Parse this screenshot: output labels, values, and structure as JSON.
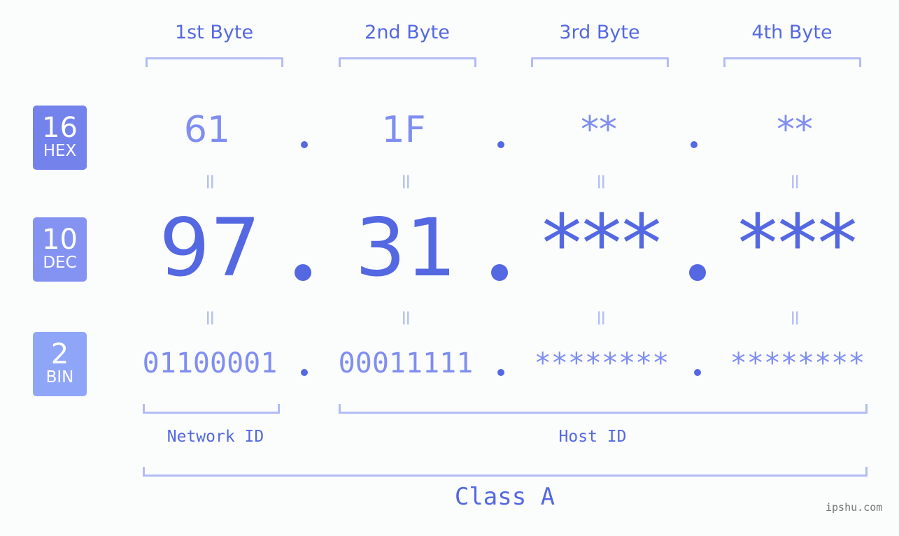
{
  "bytes": [
    {
      "header": "1st Byte",
      "hex": "61",
      "dec": "97",
      "bin": "01100001"
    },
    {
      "header": "2nd Byte",
      "hex": "1F",
      "dec": "31",
      "bin": "00011111"
    },
    {
      "header": "3rd Byte",
      "hex": "**",
      "dec": "***",
      "bin": "********"
    },
    {
      "header": "4th Byte",
      "hex": "**",
      "dec": "***",
      "bin": "********"
    }
  ],
  "bases": {
    "hex": {
      "num": "16",
      "label": "HEX",
      "color": "#7482ec"
    },
    "dec": {
      "num": "10",
      "label": "DEC",
      "color": "#8493f1"
    },
    "bin": {
      "num": "2",
      "label": "BIN",
      "color": "#8fa6f8"
    }
  },
  "equals_symbol": "=",
  "network_id_label": "Network ID",
  "host_id_label": "Host ID",
  "class_label": "Class A",
  "watermark": "ipshu.com",
  "colors": {
    "primary": "#5468e2",
    "light": "#7f8ef0",
    "bracket": "#b3bcf6"
  }
}
